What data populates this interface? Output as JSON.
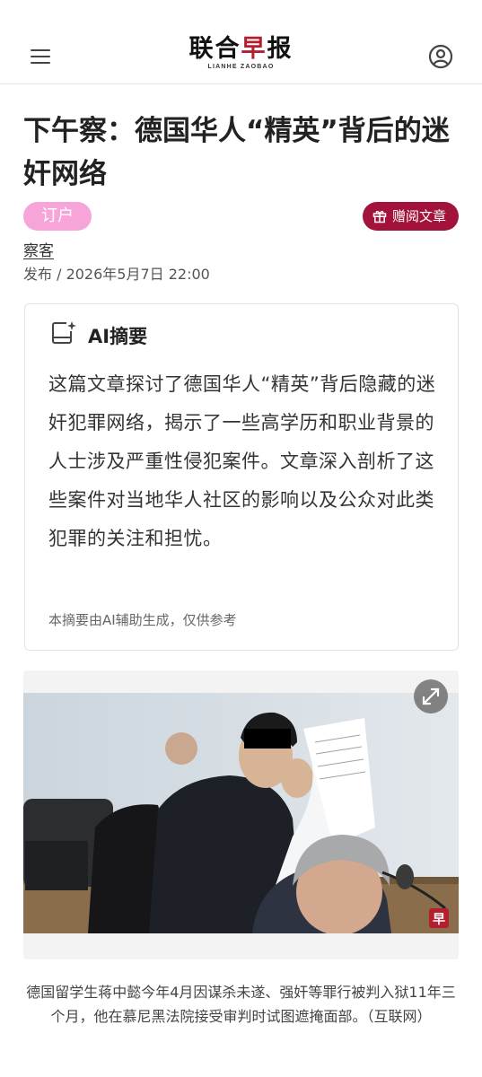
{
  "header": {
    "logo_main_a": "联合",
    "logo_main_b": "早",
    "logo_main_c": "报",
    "logo_sub": "LIANHE ZAOBAO",
    "menu_icon": "hamburger-menu-icon",
    "user_icon": "user-account-icon"
  },
  "article": {
    "title": "下午察：德国华人“精英”背后的迷奸网络",
    "tag": "订户",
    "gift_label": "赠阅文章",
    "gift_icon": "gift-icon",
    "author": "察客",
    "published": "发布 / 2026年5月7日 22:00"
  },
  "ai_summary": {
    "icon": "ai-sparkle-document-icon",
    "title": "AI摘要",
    "text": "这篇文章探讨了德国华人“精英”背后隐藏的迷奸犯罪网络，揭示了一些高学历和职业背景的人士涉及严重性侵犯案件。文章深入剖析了这些案件对当地华人社区的影响以及公众对此类犯罪的关注和担忧。",
    "note": "本摘要由AI辅助生成，仅供参考"
  },
  "image": {
    "expand_icon": "expand-arrows-icon",
    "watermark": "早",
    "caption": "德国留学生蒋中懿今年4月因谋杀未遂、强奸等罪行被判入狱11年三个月，他在慕尼黑法院接受审判时试图遮掩面部。（互联网）"
  },
  "colors": {
    "brand_red": "#b31f2e",
    "tag_pink": "#f6a4d9",
    "gift_crimson": "#a3123a"
  }
}
